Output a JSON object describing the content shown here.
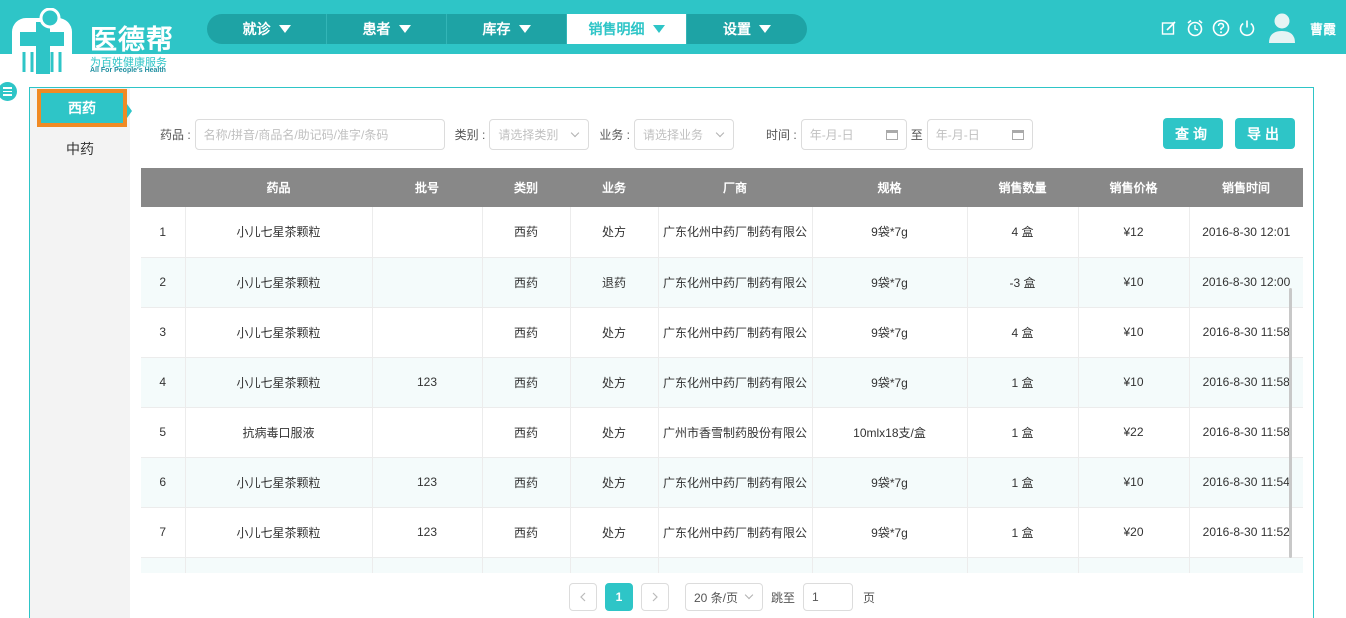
{
  "app": {
    "title": "医德帮",
    "subtitle": "为百姓健康服务",
    "tagline": "All For People's Health"
  },
  "nav": [
    {
      "label": "就诊"
    },
    {
      "label": "患者"
    },
    {
      "label": "库存"
    },
    {
      "label": "销售明细"
    },
    {
      "label": "设置"
    }
  ],
  "user": {
    "name": "曹霞"
  },
  "sidebar": {
    "tabs": [
      {
        "label": "西药"
      },
      {
        "label": "中药"
      }
    ]
  },
  "filters": {
    "drug_label": "药品 :",
    "drug_placeholder": "名称/拼音/商品名/助记码/准字/条码",
    "category_label": "类别 :",
    "category_placeholder": "请选择类别",
    "business_label": "业务 :",
    "business_placeholder": "请选择业务",
    "time_label": "时间 :",
    "date_placeholder": "年-月-日",
    "to_label": "至",
    "query_label": "查询",
    "export_label": "导出"
  },
  "table": {
    "headers": [
      "",
      "药品",
      "批号",
      "类别",
      "业务",
      "厂商",
      "规格",
      "销售数量",
      "销售价格",
      "销售时间"
    ],
    "rows": [
      [
        "1",
        "小儿七星茶颗粒",
        "",
        "西药",
        "处方",
        "广东化州中药厂制药有限公",
        "9袋*7g",
        "4 盒",
        "¥12",
        "2016-8-30 12:01"
      ],
      [
        "2",
        "小儿七星茶颗粒",
        "",
        "西药",
        "退药",
        "广东化州中药厂制药有限公",
        "9袋*7g",
        "-3 盒",
        "¥10",
        "2016-8-30 12:00"
      ],
      [
        "3",
        "小儿七星茶颗粒",
        "",
        "西药",
        "处方",
        "广东化州中药厂制药有限公",
        "9袋*7g",
        "4 盒",
        "¥10",
        "2016-8-30 11:58"
      ],
      [
        "4",
        "小儿七星茶颗粒",
        "123",
        "西药",
        "处方",
        "广东化州中药厂制药有限公",
        "9袋*7g",
        "1 盒",
        "¥10",
        "2016-8-30 11:58"
      ],
      [
        "5",
        "抗病毒口服液",
        "",
        "西药",
        "处方",
        "广州市香雪制药股份有限公",
        "10mlx18支/盒",
        "1 盒",
        "¥22",
        "2016-8-30 11:58"
      ],
      [
        "6",
        "小儿七星茶颗粒",
        "123",
        "西药",
        "处方",
        "广东化州中药厂制药有限公",
        "9袋*7g",
        "1 盒",
        "¥10",
        "2016-8-30 11:54"
      ],
      [
        "7",
        "小儿七星茶颗粒",
        "123",
        "西药",
        "处方",
        "广东化州中药厂制药有限公",
        "9袋*7g",
        "1 盒",
        "¥20",
        "2016-8-30 11:52"
      ]
    ]
  },
  "pagination": {
    "current": "1",
    "page_size": "20 条/页",
    "jump_label": "跳至",
    "jump_value": "1",
    "page_suffix": "页"
  },
  "colors": {
    "brand": "#2ec5c7",
    "highlight": "#f08a24",
    "table_header": "#888888"
  }
}
